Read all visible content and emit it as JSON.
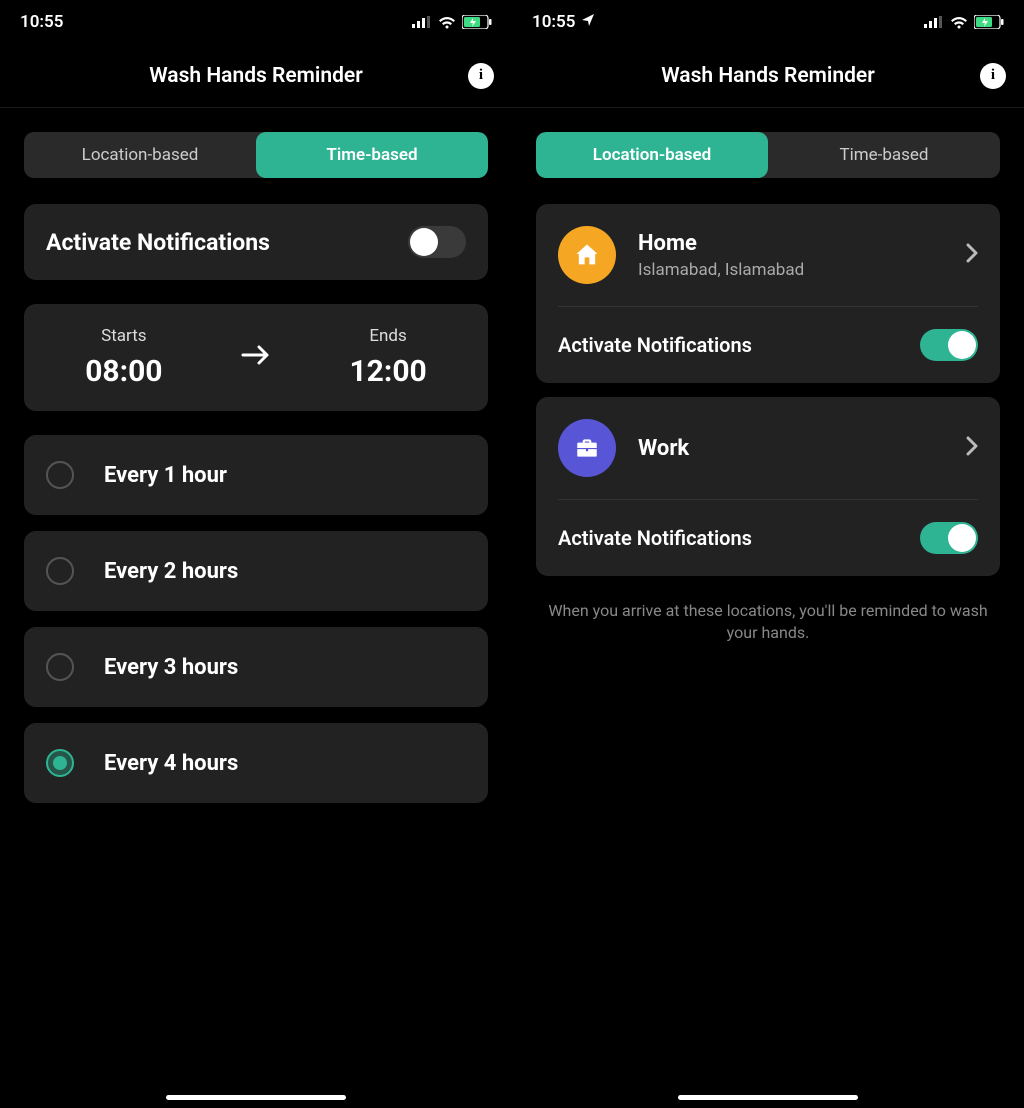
{
  "status": {
    "time": "10:55"
  },
  "header": {
    "title": "Wash Hands Reminder"
  },
  "tabs": {
    "location": "Location-based",
    "time": "Time-based"
  },
  "timeView": {
    "activate": "Activate Notifications",
    "startsLabel": "Starts",
    "startsValue": "08:00",
    "endsLabel": "Ends",
    "endsValue": "12:00",
    "freq": [
      {
        "label": "Every 1 hour",
        "selected": false
      },
      {
        "label": "Every 2 hours",
        "selected": false
      },
      {
        "label": "Every 3 hours",
        "selected": false
      },
      {
        "label": "Every 4 hours",
        "selected": true
      }
    ]
  },
  "locView": {
    "locations": [
      {
        "name": "Home",
        "sub": "Islamabad, Islamabad",
        "icon": "home",
        "toggle": true
      },
      {
        "name": "Work",
        "sub": "",
        "icon": "work",
        "toggle": true
      }
    ],
    "activate": "Activate Notifications",
    "hint": "When you arrive at these locations, you'll be reminded to wash your hands."
  }
}
